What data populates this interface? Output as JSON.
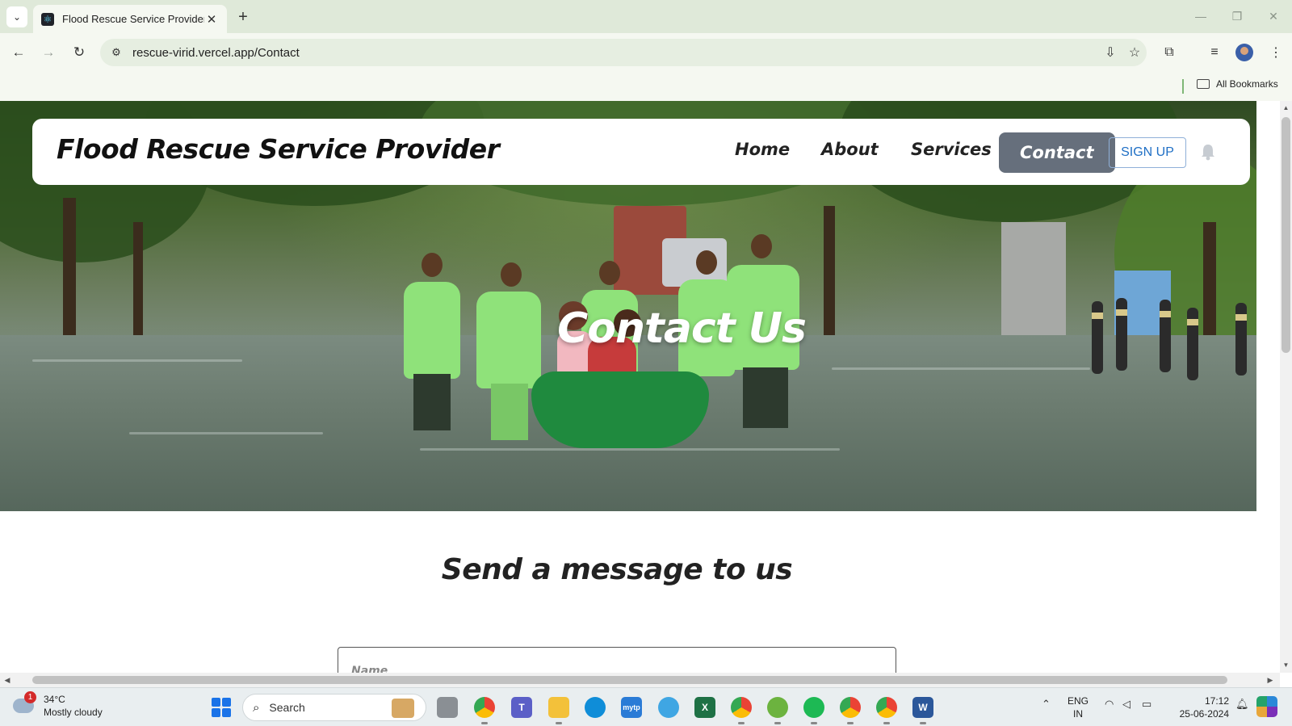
{
  "browser": {
    "tab_title": "Flood Rescue Service Provider",
    "tab_close": "✕",
    "new_tab": "+",
    "url": "rescue-virid.vercel.app/Contact",
    "bookmarks_label": "All Bookmarks"
  },
  "site": {
    "brand": "Flood Rescue Service Provider",
    "nav": {
      "home": "Home",
      "about": "About",
      "services": "Services",
      "contact": "Contact"
    },
    "signup": "SIGN UP",
    "hero_title": "Contact Us",
    "section_title": "Send a message to us",
    "name_placeholder": "Name",
    "active_nav": "Contact",
    "accent_color": "#666f7c",
    "signup_color": "#1f6fc5"
  },
  "taskbar": {
    "weather_badge": "1",
    "temperature": "34°C",
    "condition": "Mostly cloudy",
    "search_label": "Search",
    "lang_line1": "ENG",
    "lang_line2": "IN",
    "time": "17:12",
    "date": "25-06-2024"
  },
  "icons": {
    "back": "arrow-left-icon",
    "forward": "arrow-right-icon",
    "reload": "reload-icon",
    "bell": "bell-icon"
  }
}
